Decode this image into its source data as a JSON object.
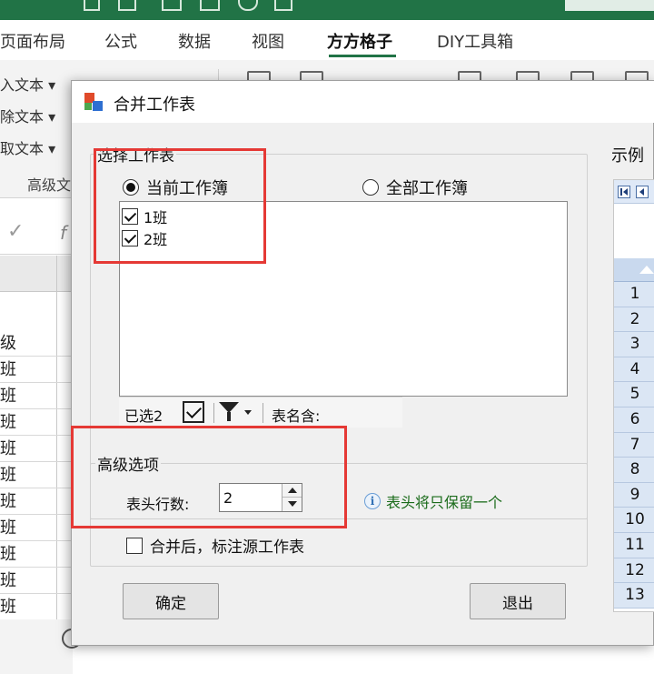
{
  "excel": {
    "ribbon_tabs": [
      {
        "label": "页面布局",
        "active": false
      },
      {
        "label": "公式",
        "active": false
      },
      {
        "label": "数据",
        "active": false
      },
      {
        "label": "视图",
        "active": false
      },
      {
        "label": "方方格子",
        "active": true
      },
      {
        "label": "DIY工具箱",
        "active": false
      }
    ],
    "ribbon_items": [
      "入文本",
      "除文本",
      "取文本"
    ],
    "ribbon_group_label": "高级文",
    "formula_icon": "f",
    "column_header": "级",
    "rows": [
      "班",
      "班",
      "班",
      "班",
      "班",
      "班",
      "班",
      "班",
      "班",
      "班"
    ],
    "theme_color": "#217346"
  },
  "dialog": {
    "title": "合并工作表",
    "select_group": {
      "label": "选择工作表",
      "radio_current": "当前工作簿",
      "radio_all": "全部工作簿",
      "selected_radio": "current",
      "sheets": [
        {
          "name": "1班",
          "checked": true
        },
        {
          "name": "2班",
          "checked": true
        }
      ],
      "toolbar": {
        "selected_count": "已选2",
        "name_contains_label": "表名含:"
      }
    },
    "advanced": {
      "label": "高级选项",
      "header_rows_label": "表头行数:",
      "header_rows_value": "2",
      "info_text": "表头将只保留一个",
      "mark_source_label": "合并后，标注源工作表",
      "mark_source_checked": false
    },
    "buttons": {
      "ok": "确定",
      "exit": "退出"
    },
    "preview": {
      "label": "示例",
      "row_numbers": [
        "1",
        "2",
        "3",
        "4",
        "5",
        "6",
        "7",
        "8",
        "9",
        "10",
        "11",
        "12",
        "13"
      ]
    }
  },
  "annotation_color": "#e53935"
}
